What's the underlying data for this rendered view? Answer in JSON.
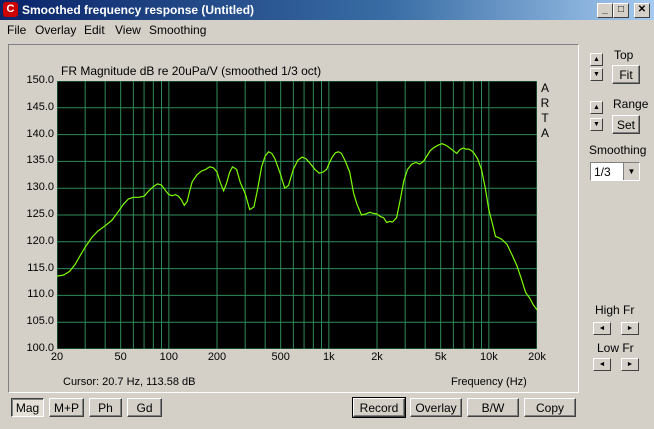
{
  "window": {
    "title": "Smoothed frequency response (Untitled)",
    "icon_name": "arta-app-icon",
    "minimize_glyph": "_",
    "maximize_glyph": "□",
    "close_glyph": "✕"
  },
  "menu": [
    "File",
    "Overlay",
    "Edit",
    "View",
    "Smoothing"
  ],
  "chart": {
    "brand": [
      "A",
      "R",
      "T",
      "A"
    ],
    "cursor_text": "Cursor: 20.7 Hz, 113.58 dB"
  },
  "chart_data": {
    "type": "line",
    "title": "FR Magnitude dB re 20uPa/V (smoothed 1/3 oct)",
    "xlabel": "Frequency (Hz)",
    "ylabel": "",
    "x_scale": "log",
    "xlim": [
      20,
      20000
    ],
    "ylim": [
      100,
      150
    ],
    "x_ticks": [
      "20",
      "50",
      "100",
      "200",
      "500",
      "1k",
      "2k",
      "5k",
      "10k",
      "20k"
    ],
    "y_ticks": [
      "150.0",
      "145.0",
      "140.0",
      "135.0",
      "130.0",
      "125.0",
      "120.0",
      "115.0",
      "110.0",
      "105.0",
      "100.0"
    ],
    "grid": true,
    "background": "#000000",
    "grid_color": "#2e8b57",
    "series": [
      {
        "line_color": "#7CFC00",
        "x": [
          20,
          22,
          24,
          26,
          28,
          30,
          33,
          36,
          40,
          44,
          48,
          52,
          56,
          60,
          65,
          70,
          75,
          80,
          85,
          90,
          95,
          100,
          105,
          110,
          115,
          120,
          125,
          130,
          135,
          140,
          150,
          160,
          170,
          180,
          190,
          200,
          210,
          220,
          230,
          240,
          250,
          265,
          280,
          300,
          320,
          340,
          360,
          380,
          400,
          420,
          440,
          460,
          480,
          500,
          530,
          560,
          600,
          640,
          680,
          720,
          770,
          820,
          870,
          920,
          970,
          1000,
          1050,
          1100,
          1150,
          1200,
          1270,
          1350,
          1430,
          1500,
          1600,
          1700,
          1800,
          1900,
          2000,
          2100,
          2200,
          2300,
          2400,
          2500,
          2650,
          2800,
          2950,
          3100,
          3300,
          3500,
          3700,
          3900,
          4100,
          4300,
          4500,
          4800,
          5100,
          5400,
          5700,
          6000,
          6300,
          6600,
          6900,
          7200,
          7500,
          7800,
          8100,
          8500,
          9000,
          9500,
          10000,
          10500,
          11000,
          11500,
          12000,
          13000,
          14000,
          15000,
          16000,
          17000,
          18000,
          19000,
          20000
        ],
        "y": [
          113.6,
          113.8,
          114.5,
          115.8,
          117.5,
          119.0,
          120.8,
          122.0,
          123.0,
          124.0,
          125.5,
          127.0,
          128.0,
          128.3,
          128.3,
          128.5,
          129.5,
          130.3,
          130.8,
          130.6,
          129.6,
          128.8,
          128.6,
          128.8,
          128.5,
          127.8,
          126.8,
          127.5,
          129.5,
          131.2,
          132.5,
          133.2,
          133.5,
          134.0,
          133.8,
          133.0,
          131.0,
          129.5,
          131.0,
          133.0,
          134.0,
          133.5,
          131.0,
          129.0,
          126.0,
          126.5,
          130.0,
          134.0,
          136.0,
          136.8,
          136.5,
          135.5,
          134.0,
          132.5,
          130.0,
          130.5,
          133.5,
          135.2,
          135.8,
          135.5,
          134.5,
          133.5,
          132.8,
          133.0,
          133.5,
          134.5,
          135.8,
          136.6,
          136.8,
          136.5,
          135.0,
          133.0,
          129.0,
          127.0,
          125.0,
          125.2,
          125.5,
          125.3,
          125.2,
          124.7,
          124.5,
          123.6,
          123.8,
          123.7,
          124.5,
          128.0,
          131.5,
          133.5,
          134.5,
          134.8,
          134.5,
          135.0,
          136.0,
          137.0,
          137.5,
          138.0,
          138.3,
          138.0,
          137.5,
          137.0,
          136.5,
          137.2,
          137.5,
          137.3,
          137.3,
          137.0,
          136.5,
          135.5,
          133.5,
          130.0,
          126.0,
          123.5,
          121.0,
          120.8,
          120.5,
          119.5,
          117.5,
          115.5,
          113.0,
          110.5,
          109.5,
          108.2,
          107.3
        ]
      }
    ]
  },
  "tabs": [
    {
      "label": "Mag",
      "active": true
    },
    {
      "label": "M+P",
      "active": false
    },
    {
      "label": "Ph",
      "active": false
    },
    {
      "label": "Gd",
      "active": false
    }
  ],
  "actions": {
    "record": "Record",
    "overlay": "Overlay",
    "bw": "B/W",
    "copy": "Copy"
  },
  "side": {
    "top_label": "Top",
    "fit_button": "Fit",
    "range_label": "Range",
    "set_button": "Set",
    "smoothing_label": "Smoothing",
    "smoothing_value": "1/3",
    "high_fr_label": "High Fr",
    "low_fr_label": "Low Fr",
    "up_glyph": "▲",
    "down_glyph": "▼",
    "left_glyph": "◄",
    "right_glyph": "►"
  }
}
